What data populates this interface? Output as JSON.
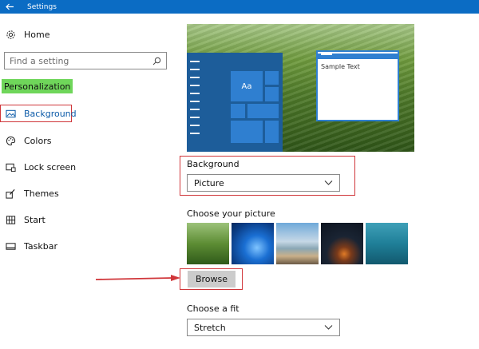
{
  "titlebar": {
    "back_icon": "back-arrow-icon",
    "title": "Settings"
  },
  "sidebar": {
    "home": {
      "label": "Home",
      "icon": "gear-icon"
    },
    "search": {
      "placeholder": "Find a setting",
      "icon": "search-icon"
    },
    "section_label": "Personalization",
    "items": [
      {
        "label": "Background",
        "icon": "picture-icon",
        "selected": true
      },
      {
        "label": "Colors",
        "icon": "palette-icon"
      },
      {
        "label": "Lock screen",
        "icon": "lock-screen-icon"
      },
      {
        "label": "Themes",
        "icon": "brush-icon"
      },
      {
        "label": "Start",
        "icon": "start-grid-icon"
      },
      {
        "label": "Taskbar",
        "icon": "taskbar-icon"
      }
    ]
  },
  "preview": {
    "tile_label": "Aa",
    "sample_text": "Sample Text"
  },
  "background": {
    "label": "Background",
    "value": "Picture"
  },
  "choose_picture": {
    "label": "Choose your picture",
    "browse_label": "Browse"
  },
  "fit": {
    "label": "Choose a fit",
    "value": "Stretch"
  },
  "colors": {
    "accent": "#0b6cc4",
    "highlight": "#6fd65a",
    "annotation": "#d0363a"
  }
}
